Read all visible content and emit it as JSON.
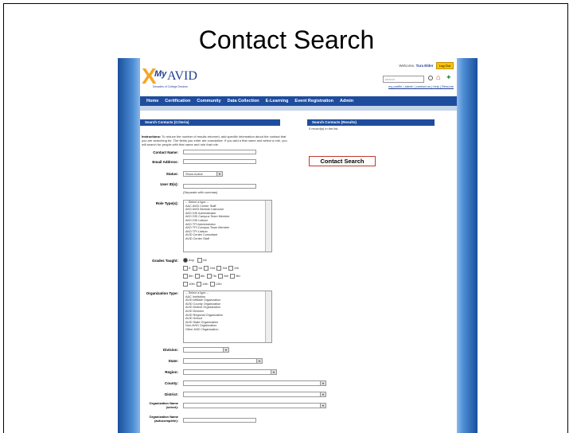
{
  "slide": {
    "title": "Contact Search"
  },
  "header": {
    "logo_my": "My",
    "logo_avid": "AVID",
    "logo_x": "X",
    "tagline": "Decades of College Dreams",
    "welcome_text": "Welcome,",
    "user_name": "Tura Elder",
    "login_label": "Log Out",
    "search_placeholder": "search",
    "top_links": "my profile | admin | contact us | help | Resume"
  },
  "nav": {
    "items": [
      "Home",
      "Certification",
      "Community",
      "Data Collection",
      "E-Learning",
      "Event Registration",
      "Admin"
    ]
  },
  "search_panel": {
    "title": "Search Contacts (Criteria)",
    "instructions_label": "Instructions:",
    "instructions_text": "To reduce the number of results returned, add specific information about the contact that you are searching for. The fields you enter are cumulative. If you add a first name and select a role, you will search for people with that name and role that role."
  },
  "results_panel": {
    "title": "Search Contacts (Results)",
    "count_text": "0 record(s) in the list."
  },
  "fields": {
    "contact_name": "Contact Name:",
    "email": "Email Address:",
    "status": "Status:",
    "status_value": "Show Active",
    "user_ids": "User ID(s):",
    "user_ids_hint": "(Separate with commas)",
    "role_types": "Role Type(s):",
    "role_options": [
      "-- Select a type --",
      "AAC AVID Center Staff",
      "AKD AVID Beneair Instructor",
      "AKD DSI Administrator",
      "AKD DSI Campus Team Member",
      "AKD DSI Liaison",
      "AKD TPI Administrator",
      "AKD TPI Campus Team Member",
      "AKD TPI Liaison",
      "AVID Center Consultant",
      "AVID Center Staff"
    ],
    "grades_taught": "Grades Taught:",
    "grade_any": "Any",
    "grade_all": "All",
    "grade_row1": [
      "K",
      "1st",
      "2nd",
      "3rd",
      "4th"
    ],
    "grade_row2": [
      "5th",
      "6th",
      "7th",
      "8th",
      "9th"
    ],
    "grade_row3": [
      "10th",
      "11th",
      "12th"
    ],
    "org_type": "Organization Type:",
    "org_options": [
      "-- Select a type --",
      "AAC Institution",
      "AVID Affiliate Organization",
      "AVID County Organization",
      "AVID District Organization",
      "AVID Division",
      "AVID Regional Organization",
      "AVID School",
      "AVID State Organization",
      "Non-AVID Organization",
      "Other AVID Organization"
    ],
    "division": "Division:",
    "state": "State:",
    "region": "Region:",
    "county": "County:",
    "district": "District:",
    "org_name_select": "Organization Name (select):",
    "org_name_auto": "Organization Name (autocomplete):"
  },
  "contact_search_button": "Contact Search"
}
